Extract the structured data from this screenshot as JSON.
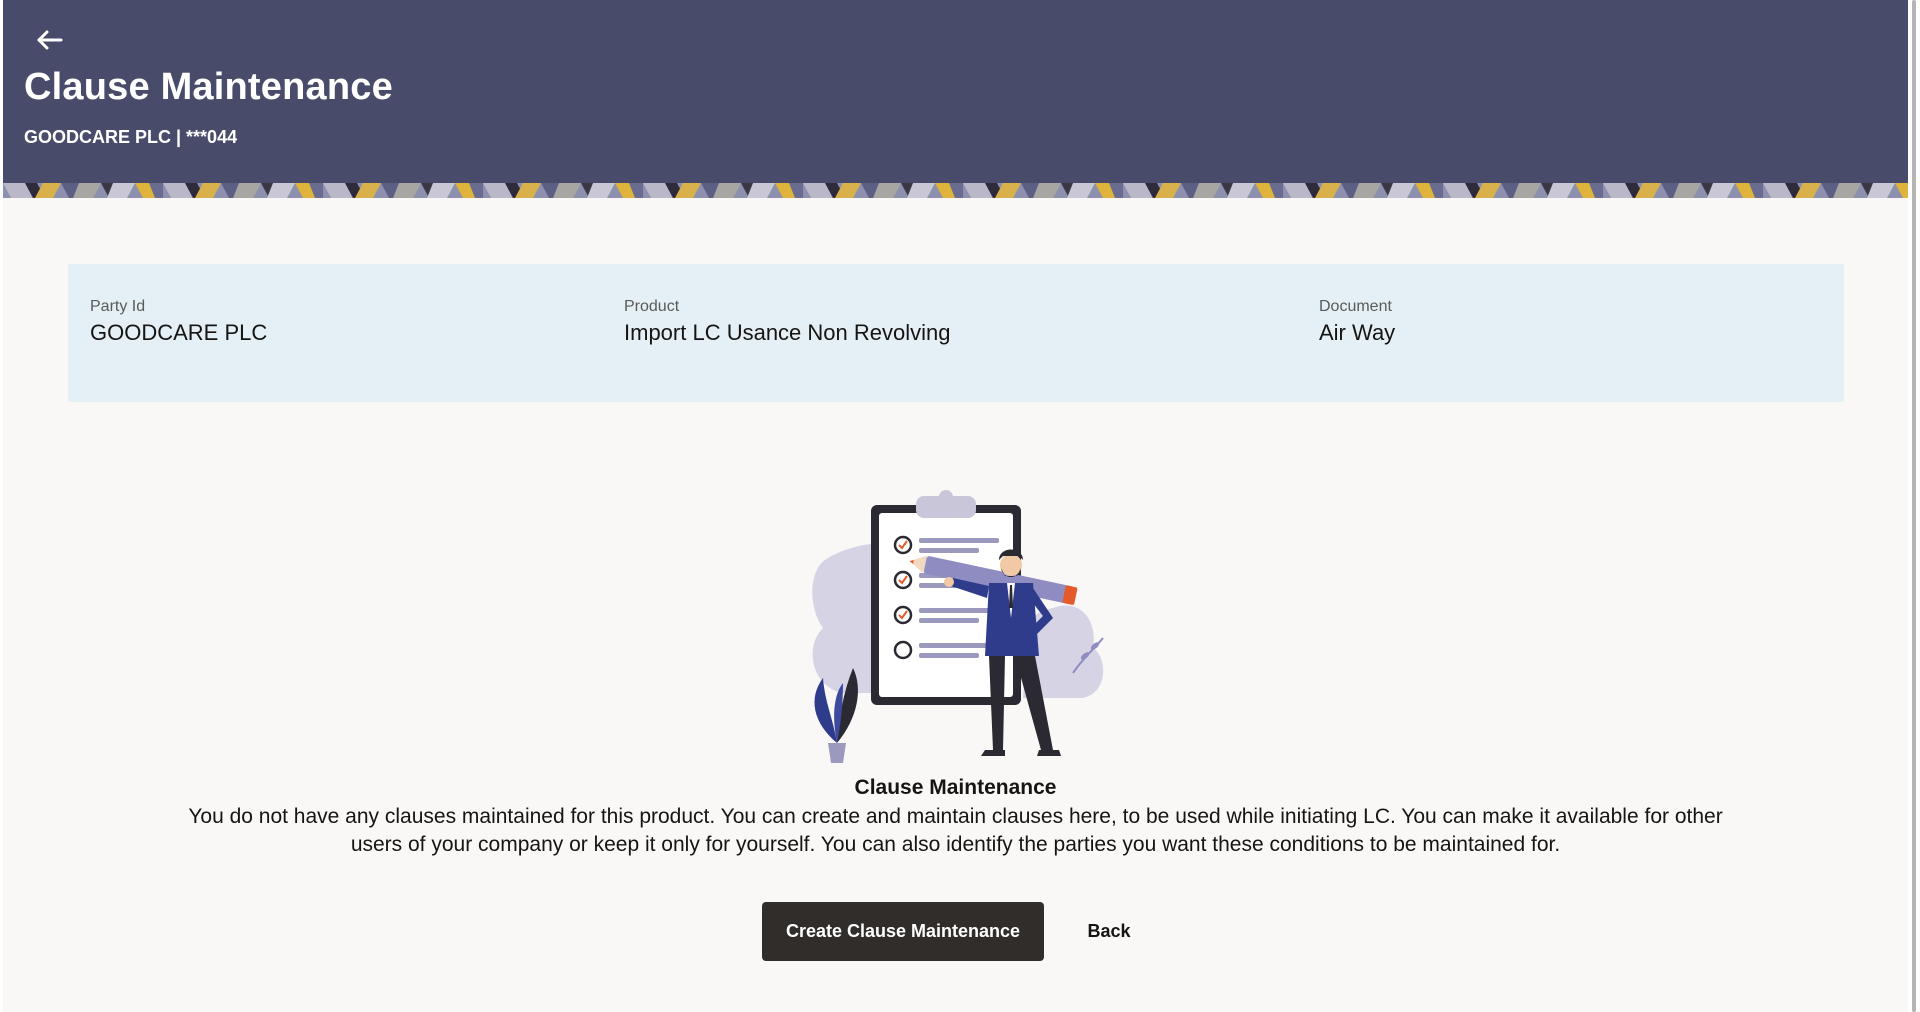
{
  "header": {
    "title": "Clause Maintenance",
    "subtitle": "GOODCARE PLC | ***044",
    "background_color": "#484c6a",
    "back_icon": "arrow-left-icon"
  },
  "summary": {
    "party_id": {
      "label": "Party Id",
      "value": "GOODCARE PLC"
    },
    "product": {
      "label": "Product",
      "value": "Import LC Usance Non Revolving"
    },
    "document": {
      "label": "Document",
      "value": "Air Way"
    }
  },
  "empty_state": {
    "illustration": "clipboard-checklist-illustration",
    "title": "Clause Maintenance",
    "description": "You do not have any clauses maintained for this product. You can create and maintain clauses here, to be used while initiating LC. You can make it available for other users of your company or keep it only for yourself. You can also identify the parties you want these conditions to be maintained for."
  },
  "actions": {
    "create_label": "Create Clause Maintenance",
    "back_label": "Back"
  },
  "colors": {
    "primary_button": "#312d2a",
    "info_panel": "#e4f0f6",
    "page_background": "#f9f8f7"
  }
}
